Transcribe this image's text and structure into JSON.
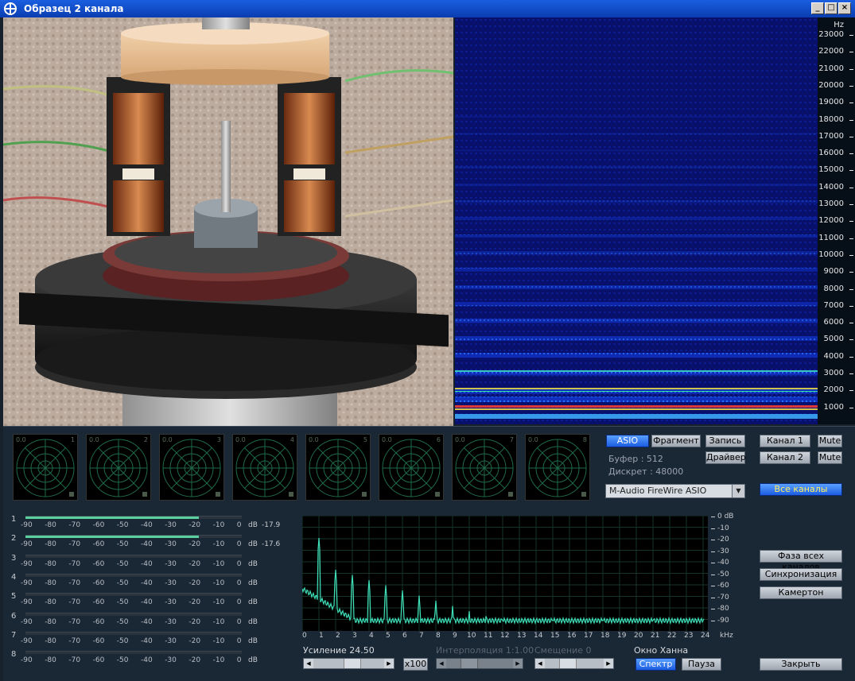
{
  "window": {
    "title": "Образец 2 канала",
    "min": "_",
    "max": "□",
    "close": "×"
  },
  "spectrogram": {
    "unit": "Hz",
    "freq_labels": [
      "23000",
      "22000",
      "21000",
      "20000",
      "19000",
      "18000",
      "17000",
      "16000",
      "15000",
      "14000",
      "13000",
      "12000",
      "11000",
      "10000",
      "9000",
      "8000",
      "7000",
      "6000",
      "5000",
      "4000",
      "3000",
      "2000",
      "1000"
    ]
  },
  "scopes": [
    {
      "level": "0.0",
      "number": "1"
    },
    {
      "level": "0.0",
      "number": "2"
    },
    {
      "level": "0.0",
      "number": "3"
    },
    {
      "level": "0.0",
      "number": "4"
    },
    {
      "level": "0.0",
      "number": "5"
    },
    {
      "level": "0.0",
      "number": "6"
    },
    {
      "level": "0.0",
      "number": "7"
    },
    {
      "level": "0.0",
      "number": "8"
    }
  ],
  "toolbar": {
    "asio": "ASIO",
    "fragment": "Фрагмент",
    "record": "Запись",
    "driver": "Драйвер"
  },
  "audio": {
    "buffer": "Буфер    : 512",
    "sample_rate": "Дискрет : 48000"
  },
  "driver_select": {
    "value": "M-Audio FireWire ASIO"
  },
  "channels": {
    "ch1": "Канал 1",
    "ch2": "Канал 2",
    "mute": "Mute",
    "all": "Все каналы"
  },
  "meters": {
    "ticks": [
      "-90",
      "-80",
      "-70",
      "-60",
      "-50",
      "-40",
      "-30",
      "-20",
      "-10",
      "0"
    ],
    "db_label": "dB",
    "rows": [
      {
        "num": "1",
        "value": "-17.9",
        "level": 0.8
      },
      {
        "num": "2",
        "value": "-17.6",
        "level": 0.8
      },
      {
        "num": "3",
        "value": "",
        "level": 0
      },
      {
        "num": "4",
        "value": "",
        "level": 0
      },
      {
        "num": "5",
        "value": "",
        "level": 0
      },
      {
        "num": "6",
        "value": "",
        "level": 0
      },
      {
        "num": "7",
        "value": "",
        "level": 0
      },
      {
        "num": "8",
        "value": "",
        "level": 0
      }
    ]
  },
  "fft": {
    "y_labels": [
      "0 dB",
      "-10",
      "-20",
      "-30",
      "-40",
      "-50",
      "-60",
      "-70",
      "-80",
      "-90"
    ],
    "x_labels": [
      "0",
      "1",
      "2",
      "3",
      "4",
      "5",
      "6",
      "7",
      "8",
      "9",
      "10",
      "11",
      "12",
      "13",
      "14",
      "15",
      "16",
      "17",
      "18",
      "19",
      "20",
      "21",
      "22",
      "23",
      "24"
    ],
    "x_unit": "kHz"
  },
  "controls": {
    "gain": "Усиление 24.50",
    "x100": "x100",
    "interp": "Интерполяция 1:1.00",
    "offset": "Смещение 0",
    "window": "Окно Ханна",
    "spectrum": "Спектр",
    "pause": "Пауза",
    "phase_all": "Фаза всех каналов",
    "sync": "Синхронизация",
    "tuning_fork": "Камертон",
    "close": "Закрыть"
  },
  "colors": {
    "accent": "#1c5ce0",
    "spectrum_trace": "#3ee0b8",
    "grid": "#1a4a3a"
  }
}
